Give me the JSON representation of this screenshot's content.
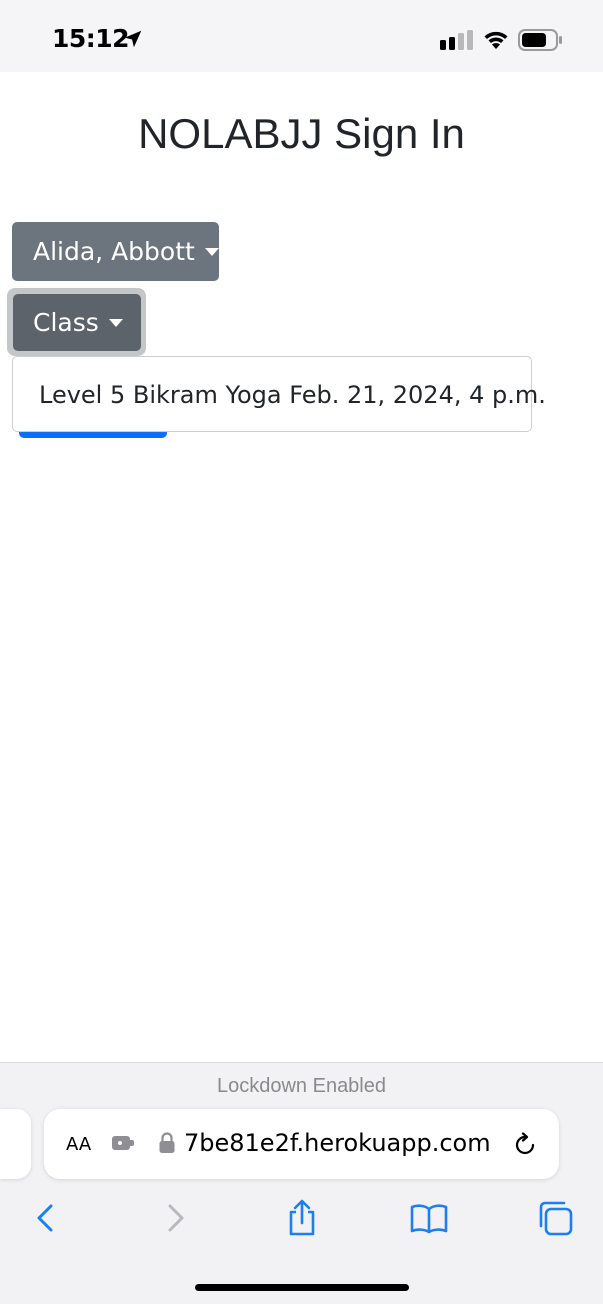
{
  "status_bar": {
    "time": "15:12",
    "icons": [
      "location-arrow-icon",
      "cellular-signal-icon",
      "wifi-icon",
      "battery-icon"
    ]
  },
  "page": {
    "title": "NOLABJJ Sign In"
  },
  "form": {
    "student_dropdown_label": "Alida, Abbott",
    "class_dropdown_label": "Class",
    "class_options": [
      "Level 5 Bikram Yoga Feb. 21, 2024, 4 p.m."
    ]
  },
  "browser": {
    "lockdown_label": "Lockdown Enabled",
    "text_size_label": "AA",
    "url": "7be81e2f.herokuapp.com",
    "toolbar": [
      "back-icon",
      "forward-icon",
      "share-icon",
      "bookmarks-icon",
      "tabs-icon"
    ]
  },
  "colors": {
    "secondary_button": "#6c757d",
    "secondary_button_active": "#5c636a",
    "primary_button": "#0d6efd",
    "browser_accent": "#1a7ff0"
  }
}
